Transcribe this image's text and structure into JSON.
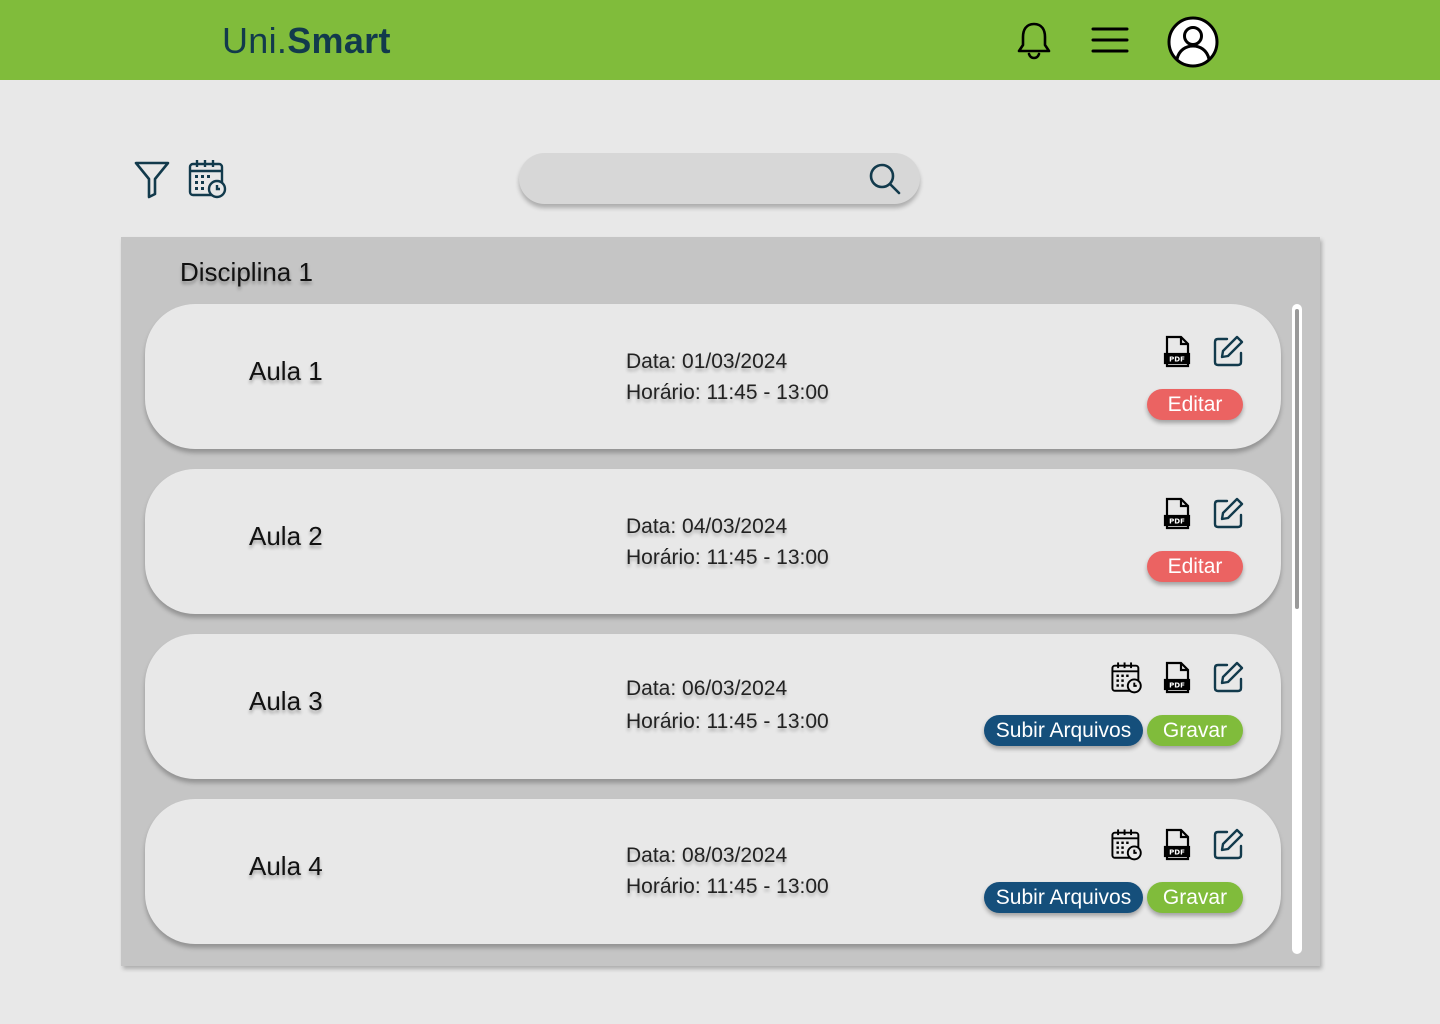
{
  "app": {
    "logo_prefix": "Uni.",
    "logo_bold": "Smart"
  },
  "search": {
    "value": "",
    "placeholder": ""
  },
  "panel": {
    "title": "Disciplina 1"
  },
  "aulas": [
    {
      "title": "Aula 1",
      "date": "Data: 01/03/2024",
      "time": "Horário: 11:45 - 13:00",
      "edit_label": "Editar"
    },
    {
      "title": "Aula 2",
      "date": "Data: 04/03/2024",
      "time": "Horário: 11:45 - 13:00",
      "edit_label": "Editar"
    },
    {
      "title": "Aula 3",
      "date": "Data: 06/03/2024",
      "time": "Horário: 11:45 - 13:00",
      "upload_label": "Subir Arquivos",
      "record_label": "Gravar"
    },
    {
      "title": "Aula 4",
      "date": "Data: 08/03/2024",
      "time": "Horário: 11:45 - 13:00",
      "upload_label": "Subir Arquivos",
      "record_label": "Gravar"
    }
  ],
  "icons": {
    "header": [
      "bell-icon",
      "menu-icon",
      "user-icon"
    ],
    "toolbar": [
      "filter-icon",
      "calendar-clock-icon",
      "search-icon"
    ],
    "card": [
      "calendar-clock-icon",
      "pdf-file-icon",
      "edit-icon"
    ]
  },
  "colors": {
    "header_bg": "#80bc3b",
    "logo_text": "#123a4c",
    "page_bg": "#e8e8e8",
    "panel_bg": "#c5c5c5",
    "edit_button": "#eb6362",
    "upload_button": "#154f7b",
    "record_button": "#80bc3b",
    "icon_stroke": "#123a4c"
  }
}
